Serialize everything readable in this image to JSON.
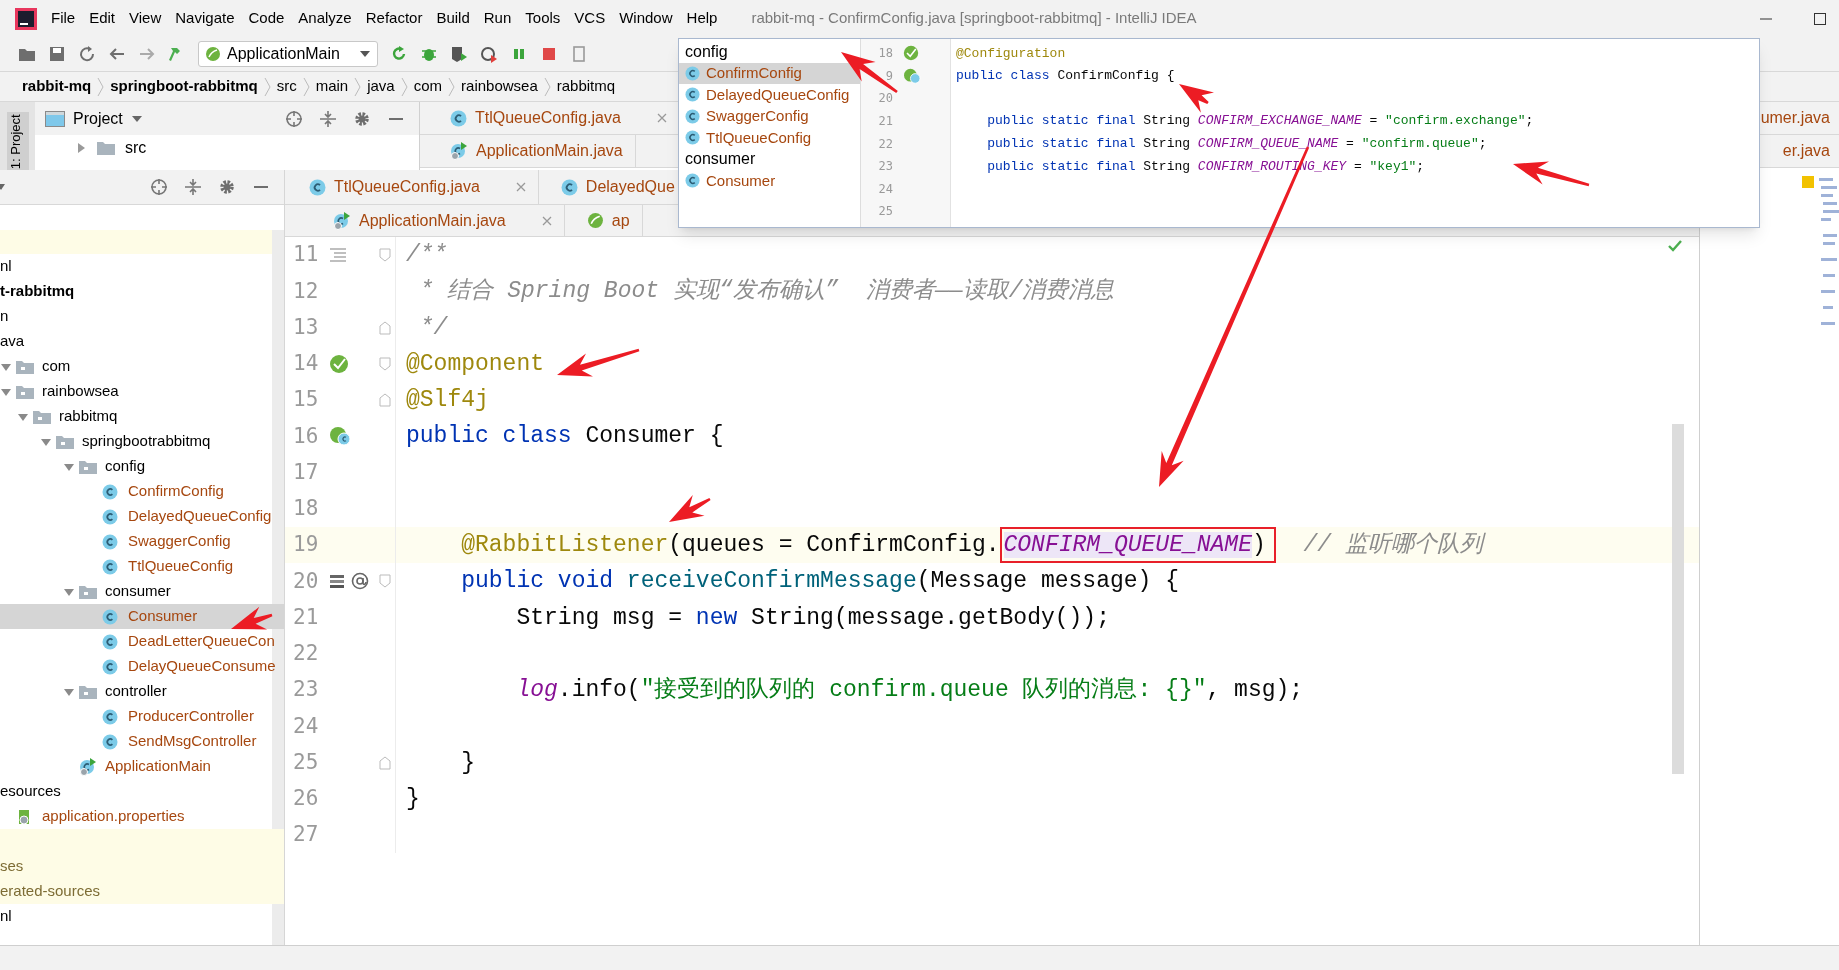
{
  "window": {
    "title": "rabbit-mq - ConfirmConfig.java [springboot-rabbitmq] - IntelliJ IDEA",
    "menu": [
      "File",
      "Edit",
      "View",
      "Navigate",
      "Code",
      "Analyze",
      "Refactor",
      "Build",
      "Run",
      "Tools",
      "VCS",
      "Window",
      "Help"
    ]
  },
  "toolbar": {
    "run_configuration": "ApplicationMain"
  },
  "breadcrumbs": [
    {
      "label": "rabbit-mq",
      "bold": true
    },
    {
      "label": "springboot-rabbitmq",
      "bold": true
    },
    {
      "label": "src",
      "bold": false
    },
    {
      "label": "main",
      "bold": false
    },
    {
      "label": "java",
      "bold": false
    },
    {
      "label": "com",
      "bold": false
    },
    {
      "label": "rainbowsea",
      "bold": false
    },
    {
      "label": "rabbitmq",
      "bold": false
    }
  ],
  "back_project_panel": {
    "stripe_label": "1: Project",
    "title": "Project",
    "tree": [
      {
        "label": "src",
        "expanded": false
      }
    ]
  },
  "back_editor_tabs": [
    {
      "tabs": [
        {
          "label": "TtlQueueConfig.java",
          "kind": "class",
          "closable": true
        }
      ],
      "edge_tab": "umer.java"
    },
    {
      "tabs": [
        {
          "label": "ApplicationMain.java",
          "kind": "main_class",
          "closable": false
        }
      ],
      "edge_tab": "er.java"
    }
  ],
  "front_editor_tabs": [
    {
      "tabs": [
        {
          "label": "TtlQueueConfig.java",
          "kind": "class",
          "closable": true
        },
        {
          "label": "DelayedQue",
          "kind": "class",
          "closable": false
        }
      ]
    },
    {
      "tabs": [
        {
          "label": "ApplicationMain.java",
          "kind": "main_class",
          "closable": true
        },
        {
          "label": "ap",
          "kind": "spring",
          "closable": false
        }
      ]
    }
  ],
  "project_tree": [
    {
      "label": "nl",
      "selected": false,
      "excluded": false
    },
    {
      "label": "t-rabbitmq",
      "kind": "module",
      "selected": false,
      "excluded": false,
      "children": [
        {
          "label": "n",
          "selected": false,
          "excluded": false,
          "children": [
            {
              "label": "ava",
              "selected": false,
              "excluded": false,
              "children": [
                {
                  "label": "com",
                  "kind": "package",
                  "selected": false,
                  "excluded": false,
                  "children": [
                    {
                      "label": "rainbowsea",
                      "kind": "package",
                      "selected": false,
                      "excluded": false,
                      "children": [
                        {
                          "label": "rabbitmq",
                          "kind": "package",
                          "selected": false,
                          "excluded": false,
                          "children": [
                            {
                              "label": "springbootrabbitmq",
                              "kind": "package",
                              "selected": false,
                              "excluded": false,
                              "children": [
                                {
                                  "label": "config",
                                  "kind": "package",
                                  "selected": false,
                                  "excluded": false,
                                  "children": [
                                    {
                                      "label": "ConfirmConfig",
                                      "kind": "class",
                                      "selected": false,
                                      "excluded": false
                                    },
                                    {
                                      "label": "DelayedQueueConfig",
                                      "kind": "class",
                                      "selected": false,
                                      "excluded": false
                                    },
                                    {
                                      "label": "SwaggerConfig",
                                      "kind": "class",
                                      "selected": false,
                                      "excluded": false
                                    },
                                    {
                                      "label": "TtlQueueConfig",
                                      "kind": "class",
                                      "selected": false,
                                      "excluded": false
                                    }
                                  ]
                                },
                                {
                                  "label": "consumer",
                                  "kind": "package",
                                  "selected": false,
                                  "excluded": false,
                                  "children": [
                                    {
                                      "label": "Consumer",
                                      "kind": "class",
                                      "selected": true,
                                      "excluded": false
                                    },
                                    {
                                      "label": "DeadLetterQueueCon",
                                      "kind": "class",
                                      "selected": false,
                                      "excluded": false
                                    },
                                    {
                                      "label": "DelayQueueConsume",
                                      "kind": "class",
                                      "selected": false,
                                      "excluded": false
                                    }
                                  ]
                                },
                                {
                                  "label": "controller",
                                  "kind": "package",
                                  "selected": false,
                                  "excluded": false,
                                  "children": [
                                    {
                                      "label": "ProducerController",
                                      "kind": "class",
                                      "selected": false,
                                      "excluded": false
                                    },
                                    {
                                      "label": "SendMsgController",
                                      "kind": "class",
                                      "selected": false,
                                      "excluded": false
                                    }
                                  ]
                                },
                                {
                                  "label": "ApplicationMain",
                                  "kind": "main_class",
                                  "selected": false,
                                  "excluded": false
                                }
                              ]
                            }
                          ]
                        }
                      ]
                    }
                  ]
                }
              ]
            },
            {
              "label": "esources",
              "selected": false,
              "excluded": false,
              "children": [
                {
                  "label": "application.properties",
                  "kind": "properties",
                  "selected": false,
                  "excluded": false
                }
              ]
            }
          ]
        },
        {
          "label": "ses",
          "selected": false,
          "excluded": true
        },
        {
          "label": "erated-sources",
          "selected": false,
          "excluded": true
        }
      ]
    },
    {
      "label": "nl",
      "selected": false,
      "excluded": false
    }
  ],
  "editor": {
    "lines": [
      {
        "number": "11",
        "fold": {
          "kind": "open"
        },
        "gutter": {
          "kind": "list"
        },
        "current": false,
        "tokens": [
          {
            "text": "/**",
            "kind": "comment"
          }
        ]
      },
      {
        "number": "12",
        "current": false,
        "tokens": [
          {
            "text": " * 结合 Spring Boot 实现“发布确认”  消费者——读取/消费消息",
            "kind": "comment"
          }
        ]
      },
      {
        "number": "13",
        "fold": {
          "kind": "close"
        },
        "current": false,
        "tokens": [
          {
            "text": " */",
            "kind": "comment"
          }
        ]
      },
      {
        "number": "14",
        "fold": {
          "kind": "open"
        },
        "gutter": {
          "kind": "bean"
        },
        "current": false,
        "tokens": [
          {
            "text": "@Component",
            "kind": "annotation"
          }
        ]
      },
      {
        "number": "15",
        "fold": {
          "kind": "close"
        },
        "current": false,
        "tokens": [
          {
            "text": "@Slf4j",
            "kind": "annotation"
          }
        ]
      },
      {
        "number": "16",
        "gutter": {
          "kind": "class_bean"
        },
        "current": false,
        "tokens": [
          {
            "text": "public class",
            "kind": "keyword"
          },
          {
            "text": " Consumer {",
            "kind": "plain"
          }
        ]
      },
      {
        "number": "17",
        "current": false
      },
      {
        "number": "18",
        "current": false
      },
      {
        "number": "19",
        "current": true,
        "tokens": [
          {
            "text": "    @RabbitListener",
            "kind": "annotation"
          },
          {
            "text": "(queues = ConfirmConfig.",
            "kind": "plain"
          },
          {
            "text": "CONFIRM_QUEUE_NAME",
            "kind": "constant",
            "boxed": true
          },
          {
            "text": ")",
            "kind": "plain",
            "boxed": true
          },
          {
            "text": "  // 监听哪个队列",
            "kind": "comment"
          }
        ]
      },
      {
        "number": "20",
        "fold": {
          "kind": "open"
        },
        "gutter": {
          "kind": "method"
        },
        "current": false,
        "tokens": [
          {
            "text": "    public void",
            "kind": "keyword"
          },
          {
            "text": " receiveConfirmMessage",
            "kind": "method"
          },
          {
            "text": "(Message message) {",
            "kind": "plain"
          }
        ]
      },
      {
        "number": "21",
        "current": false,
        "tokens": [
          {
            "text": "        String msg = ",
            "kind": "plain"
          },
          {
            "text": "new",
            "kind": "keyword"
          },
          {
            "text": " String(message.getBody());",
            "kind": "plain"
          }
        ]
      },
      {
        "number": "22",
        "current": false
      },
      {
        "number": "23",
        "current": false,
        "tokens": [
          {
            "text": "        log",
            "kind": "constant"
          },
          {
            "text": ".info(",
            "kind": "plain"
          },
          {
            "text": "\"接受到的队列的 confirm.queue 队列的消息: {}\"",
            "kind": "string"
          },
          {
            "text": ", msg);",
            "kind": "plain"
          }
        ]
      },
      {
        "number": "24",
        "current": false
      },
      {
        "number": "25",
        "fold": {
          "kind": "close"
        },
        "current": false,
        "tokens": [
          {
            "text": "    }",
            "kind": "plain"
          }
        ]
      },
      {
        "number": "26",
        "current": false,
        "tokens": [
          {
            "text": "}",
            "kind": "plain"
          }
        ]
      },
      {
        "number": "27",
        "current": false
      }
    ]
  },
  "class_popup": {
    "groups": [
      {
        "label": "config",
        "items": [
          {
            "label": "ConfirmConfig",
            "selected": true
          },
          {
            "label": "DelayedQueueConfig",
            "selected": false
          },
          {
            "label": "SwaggerConfig",
            "selected": false
          },
          {
            "label": "TtlQueueConfig",
            "selected": false
          }
        ]
      },
      {
        "label": "consumer",
        "items": [
          {
            "label": "Consumer",
            "selected": false
          }
        ]
      }
    ],
    "preview": [
      {
        "number": "18",
        "gutter": {
          "kind": "bean"
        },
        "tokens": [
          {
            "text": "@Configuration",
            "kind": "annotation"
          }
        ]
      },
      {
        "number": "9",
        "gutter": {
          "kind": "class_bean"
        },
        "tokens": [
          {
            "text": "public class",
            "kind": "keyword"
          },
          {
            "text": " ConfirmConfig {",
            "kind": "plain"
          }
        ]
      },
      {
        "number": "20"
      },
      {
        "number": "21",
        "tokens": [
          {
            "text": "    public static final",
            "kind": "keyword"
          },
          {
            "text": " String ",
            "kind": "plain"
          },
          {
            "text": "CONFIRM_EXCHANGE_NAME",
            "kind": "constant"
          },
          {
            "text": " = ",
            "kind": "plain"
          },
          {
            "text": "\"confirm.exchange\"",
            "kind": "string"
          },
          {
            "text": ";",
            "kind": "plain"
          }
        ]
      },
      {
        "number": "22",
        "tokens": [
          {
            "text": "    public static final",
            "kind": "keyword"
          },
          {
            "text": " String ",
            "kind": "plain"
          },
          {
            "text": "CONFIRM_QUEUE_NAME",
            "kind": "constant"
          },
          {
            "text": " = ",
            "kind": "plain"
          },
          {
            "text": "\"confirm.queue\"",
            "kind": "string"
          },
          {
            "text": ";",
            "kind": "plain"
          }
        ]
      },
      {
        "number": "23",
        "tokens": [
          {
            "text": "    public static final",
            "kind": "keyword"
          },
          {
            "text": " String ",
            "kind": "plain"
          },
          {
            "text": "CONFIRM_ROUTING_KEY",
            "kind": "constant"
          },
          {
            "text": " = ",
            "kind": "plain"
          },
          {
            "text": "\"key1\"",
            "kind": "string"
          },
          {
            "text": ";",
            "kind": "plain"
          }
        ]
      },
      {
        "number": "24"
      },
      {
        "number": "25"
      }
    ]
  }
}
